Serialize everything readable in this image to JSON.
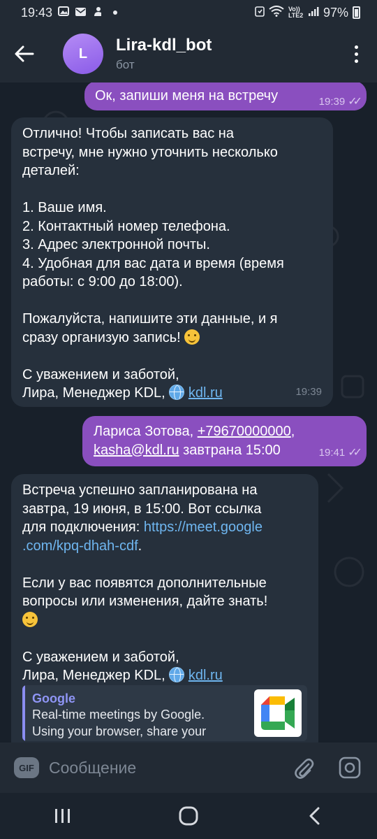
{
  "status_bar": {
    "time": "19:43",
    "battery": "97%",
    "network": "Vo)) LTE2"
  },
  "header": {
    "avatar_letter": "L",
    "title": "Lira-kdl_bot",
    "subtitle": "бот"
  },
  "messages": [
    {
      "direction": "outgoing",
      "text": "Ок, запиши меня на встречу",
      "time": "19:39",
      "read": true
    },
    {
      "direction": "incoming",
      "lines": [
        "Отлично! Чтобы записать вас на",
        "встречу, мне нужно уточнить несколько",
        "деталей:",
        "1. Ваше имя.",
        "2. Контактный номер телефона.",
        "3. Адрес электронной почты.",
        "4. Удобная для вас дата и время (время",
        "работы: с 9:00 до 18:00).",
        "Пожалуйста, напишите эти данные, и я",
        "сразу организую запись!",
        "С уважением и заботой,",
        "Лира, Менеджер KDL,"
      ],
      "link": "kdl.ru",
      "time": "19:39"
    },
    {
      "direction": "outgoing",
      "name": "Лариса Зотова,",
      "phone": "+79670000000",
      "email": "kasha@kdl.ru",
      "rest": "завтрана 15:00",
      "time": "19:41",
      "read": true
    },
    {
      "direction": "incoming",
      "lines": [
        "Встреча успешно запланирована на",
        "завтра, 19 июня, в 15:00. Вот ссылка",
        "для подключения:",
        "Если у вас появятся дополнительные",
        "вопросы или изменения, дайте знать!",
        "С уважением и заботой,",
        "Лира, Менеджер KDL,"
      ],
      "meet_link_1": "https://meet.google",
      "meet_link_2": ".com/kpq-dhah-cdf",
      "link": "kdl.ru",
      "preview": {
        "site": "Google",
        "line1": "Real-time meetings by Google.",
        "line2": "Using your browser, share your"
      }
    }
  ],
  "input": {
    "gif_label": "GIF",
    "placeholder": "Сообщение"
  },
  "colors": {
    "outgoing_bubble": "#8a4fbf",
    "incoming_bubble": "#26303c",
    "link": "#6fb6f0",
    "accent_avatar": "#9b6cf0"
  }
}
